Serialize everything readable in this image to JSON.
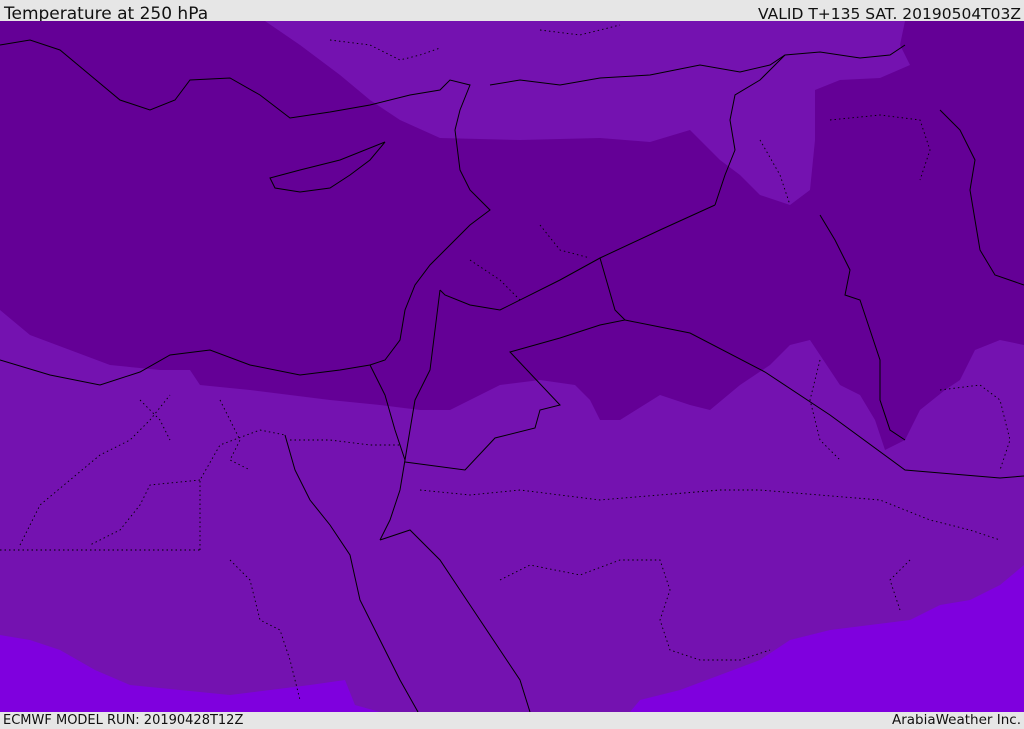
{
  "header": {
    "title": "Temperature at 250 hPa",
    "valid": "VALID T+135 SAT. 20190504T03Z"
  },
  "footer": {
    "model_run": "ECMWF MODEL RUN: 20190428T12Z",
    "credit": "ArabiaWeather Inc."
  },
  "map": {
    "colors": {
      "cold_dark": "#640096",
      "mid": "#7412b0",
      "warm": "#7f00de",
      "border": "#000000",
      "bar": "#e6e6e6"
    }
  }
}
